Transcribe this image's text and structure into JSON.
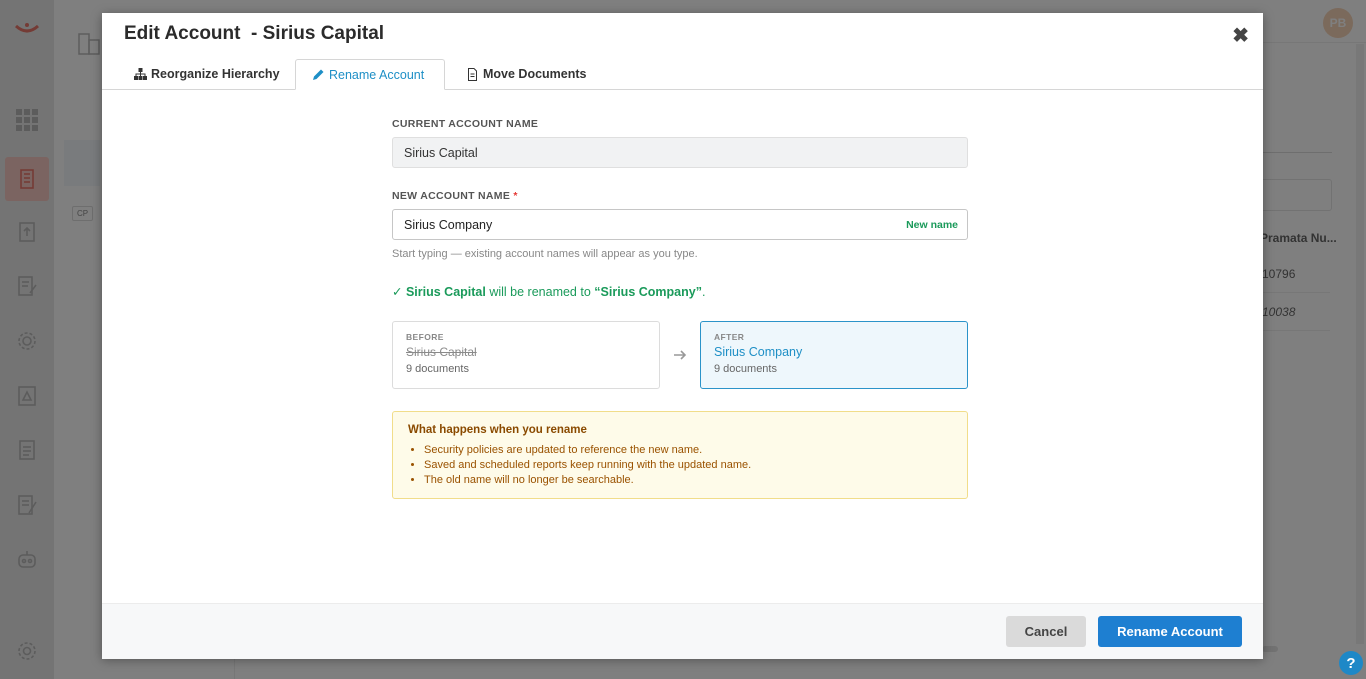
{
  "app": {
    "avatar_initials": "PB",
    "bg_badge": "CP",
    "bg_table_header": "Pramata Nu...",
    "bg_rows": [
      "10796",
      "10038"
    ],
    "help_label": "?"
  },
  "sidebar": {
    "icons": [
      "grid-icon",
      "accounts-icon",
      "upload-icon",
      "contract-edit-icon",
      "settings-icon",
      "document-upload-icon",
      "document-icon",
      "report-edit-icon",
      "bot-icon",
      "gear-icon"
    ],
    "active": "accounts-icon"
  },
  "modal": {
    "title": "Edit Account  - Sirius Capital",
    "close_label": "✖",
    "tabs": [
      {
        "label": "Reorganize Hierarchy",
        "icon": "hierarchy-icon"
      },
      {
        "label": "Rename Account",
        "icon": "pencil-icon",
        "active": true
      },
      {
        "label": "Move Documents",
        "icon": "document-icon"
      }
    ],
    "current_label": "CURRENT ACCOUNT NAME",
    "current_value": "Sirius Capital",
    "new_label": "NEW ACCOUNT NAME",
    "required_mark": "*",
    "new_value": "Sirius Company",
    "new_tag": "New name",
    "hint": "Start typing — existing account names will appear as you type.",
    "confirm": {
      "check": "✓",
      "old_name": "Sirius Capital",
      "middle": "will be renamed to",
      "new_name": "“Sirius Company”",
      "end": "."
    },
    "before": {
      "caption": "BEFORE",
      "name": "Sirius Capital",
      "docs": "9 documents"
    },
    "after": {
      "caption": "AFTER",
      "name": "Sirius Company",
      "docs": "9 documents"
    },
    "note": {
      "title": "What happens when you rename",
      "items": [
        "Security policies are updated to reference the new name.",
        "Saved and scheduled reports keep running with the updated name.",
        "The old name will no longer be searchable."
      ]
    },
    "cancel_label": "Cancel",
    "submit_label": "Rename Account"
  },
  "colors": {
    "accent": "#1e8fc6",
    "primary_button": "#1e7fd1",
    "success": "#1a9a5a",
    "warning_bg": "#fefbe9"
  }
}
